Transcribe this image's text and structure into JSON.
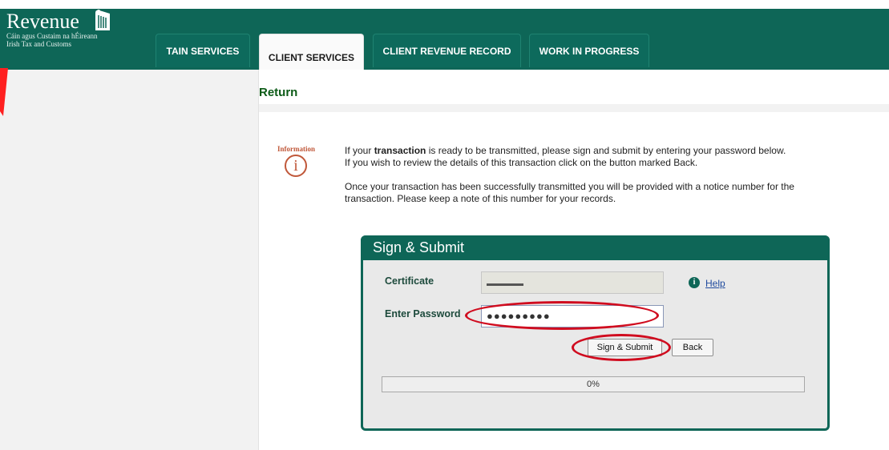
{
  "header": {
    "logo_word": "Revenue",
    "logo_line1": "Cáin agus Custaim na hÉireann",
    "logo_line2": "Irish Tax and Customs"
  },
  "tabs": [
    {
      "label": "TAIN SERVICES",
      "active": false
    },
    {
      "label": "CLIENT SERVICES",
      "active": true
    },
    {
      "label": "CLIENT REVENUE RECORD",
      "active": false
    },
    {
      "label": "WORK IN PROGRESS",
      "active": false
    }
  ],
  "page_title": "Return",
  "info": {
    "label": "Information",
    "icon": "info-icon",
    "glyph": "i",
    "p1_before": "If your ",
    "p1_bold": "transaction",
    "p1_after": " is ready to be transmitted, please sign and submit by entering your password below.",
    "p1_line2": "If you wish to review the details of this transaction click on the button marked Back.",
    "p2_line1": "Once your transaction has been successfully transmitted you will be provided with a notice number for the",
    "p2_line2": "transaction. Please keep a note of this number for your records."
  },
  "panel": {
    "title": "Sign & Submit",
    "certificate_label": "Certificate",
    "certificate_value": "",
    "password_label": "Enter Password",
    "password_value": "●●●●●●●●●",
    "help_label": "Help",
    "help_icon": "info-circle-icon",
    "sign_button": "Sign & Submit",
    "back_button": "Back",
    "progress": 0,
    "progress_text": "0%"
  },
  "colors": {
    "header": "#0e6657",
    "title_green": "#0b5a16",
    "info_orange": "#c0583a",
    "annotation_red": "#d00c1f"
  }
}
